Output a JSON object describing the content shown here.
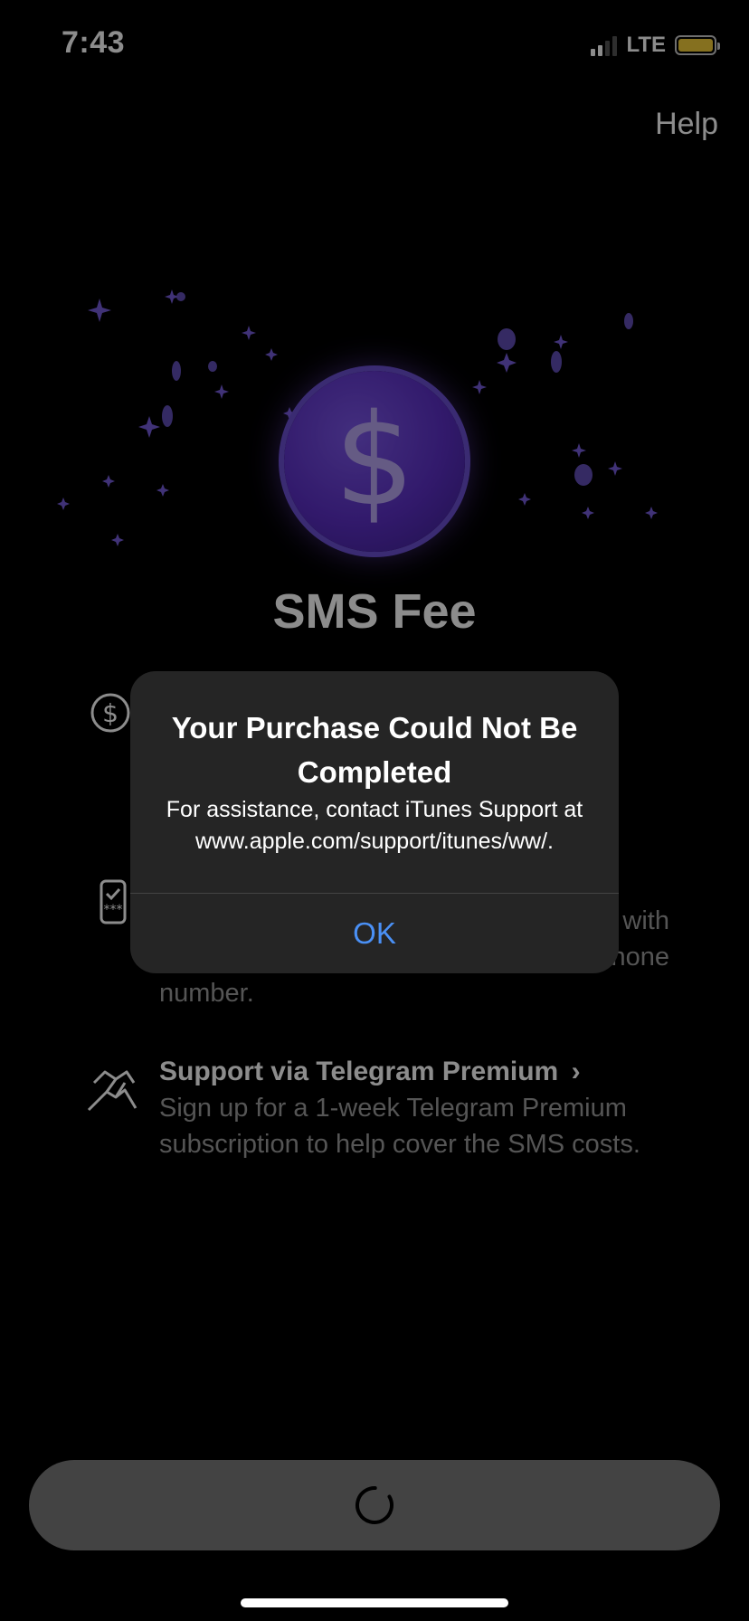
{
  "status_bar": {
    "time": "7:43",
    "network": "LTE"
  },
  "header": {
    "help_label": "Help"
  },
  "hero": {
    "coin_symbol": "$",
    "title": "SMS Fee"
  },
  "features": [
    {
      "icon": "dollar-circle-icon",
      "title": "",
      "description": ""
    },
    {
      "icon": "phone-check-icon",
      "title": "",
      "description_visible": [
        "with",
        "hone",
        "number."
      ]
    },
    {
      "icon": "handshake-icon",
      "title": "Support via Telegram Premium",
      "title_chevron": "›",
      "description": "Sign up for a 1-week Telegram Premium subscription to help cover the SMS costs."
    }
  ],
  "alert": {
    "title": "Your Purchase Could Not Be Completed",
    "message": "For assistance, contact iTunes Support at www.apple.com/support/itunes/ww/.",
    "ok_label": "OK"
  },
  "bottom_button": {
    "state": "loading",
    "icon": "spinner-icon"
  },
  "colors": {
    "background": "#000000",
    "alert_background": "#252525",
    "alert_button": "#4a90f5",
    "coin": "#5b2fc4",
    "bottom_button": "#7b7b7b",
    "battery": "#f2cd3a"
  }
}
